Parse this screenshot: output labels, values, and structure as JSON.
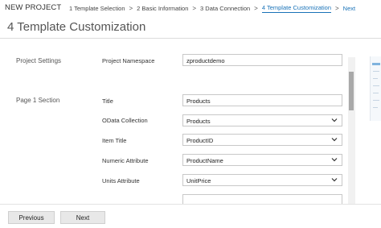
{
  "header": {
    "app_title": "NEW PROJECT",
    "breadcrumbs": [
      {
        "label": "1 Template Selection"
      },
      {
        "label": "2 Basic Information"
      },
      {
        "label": "3 Data Connection"
      },
      {
        "label": "4 Template Customization"
      },
      {
        "label": "Next"
      }
    ],
    "separator": ">"
  },
  "page": {
    "title": "4 Template Customization"
  },
  "sections": {
    "project_settings": "Project Settings",
    "page1": "Page 1 Section"
  },
  "fields": {
    "namespace": {
      "label": "Project Namespace",
      "value": "zproductdemo"
    },
    "title": {
      "label": "Title",
      "value": "Products"
    },
    "odata_collection": {
      "label": "OData Collection",
      "value": "Products"
    },
    "item_title": {
      "label": "Item Title",
      "value": "ProductID"
    },
    "numeric_attribute": {
      "label": "Numeric Attribute",
      "value": "ProductName"
    },
    "units_attribute": {
      "label": "Units Attribute",
      "value": "UnitPrice"
    }
  },
  "footer": {
    "previous_label": "Previous",
    "next_label": "Next"
  },
  "colors": {
    "accent": "#1a73b8",
    "button_bg": "#e8e8e8"
  },
  "icons": {
    "dropdown": "chevron-down-icon",
    "breadcrumb_separator": "chevron-right"
  }
}
